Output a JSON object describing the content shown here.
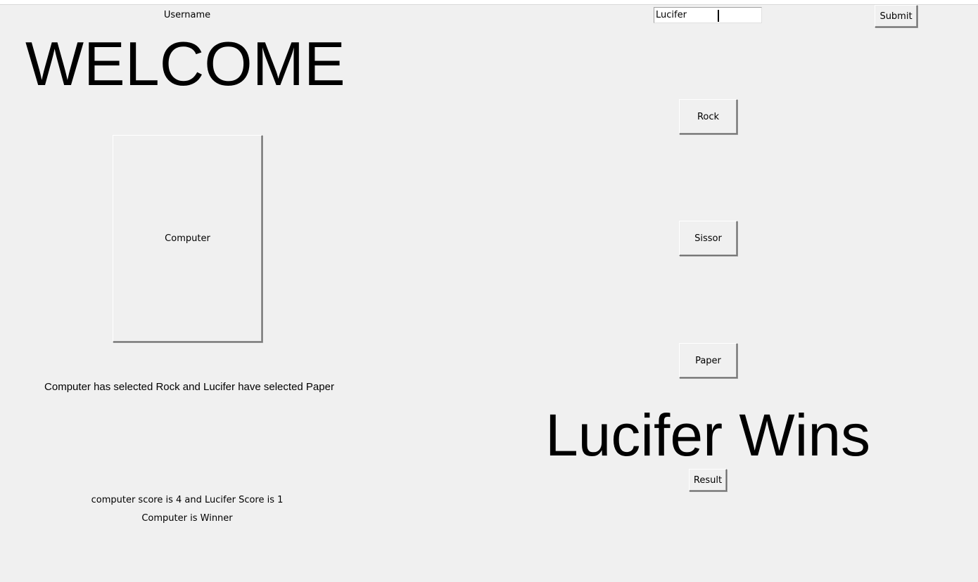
{
  "username_label": "Username",
  "username_value": "Lucifer",
  "submit_label": "Submit",
  "welcome": "WELCOME",
  "computer_label": "Computer",
  "buttons": {
    "rock": "Rock",
    "sissor": "Sissor",
    "paper": "Paper",
    "result": "Result"
  },
  "selection_message": "Computer has selected Rock and Lucifer have selected Paper",
  "round_result": "Lucifer Wins",
  "score_message": "computer score is 4 and Lucifer Score is 1",
  "winner_message": "Computer is Winner"
}
